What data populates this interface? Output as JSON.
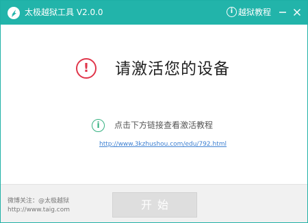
{
  "window": {
    "title": "太极越狱工具 V2.0.0",
    "tutorial_link": "越狱教程",
    "accent_color": "#22b4aa"
  },
  "main": {
    "headline": "请激活您的设备",
    "alert_icon": "!",
    "info_icon": "i",
    "info_text": "点击下方链接查看激活教程",
    "tutorial_url": "http://www.3kzhushou.com/edu/792.html"
  },
  "footer": {
    "social": "微博关注：@太极越狱",
    "website": "http://www.taig.com",
    "start_button": "开始"
  },
  "icons": [
    "app-logo-icon",
    "info-circle-icon",
    "minimize-icon",
    "close-icon",
    "alert-icon",
    "info-icon"
  ]
}
